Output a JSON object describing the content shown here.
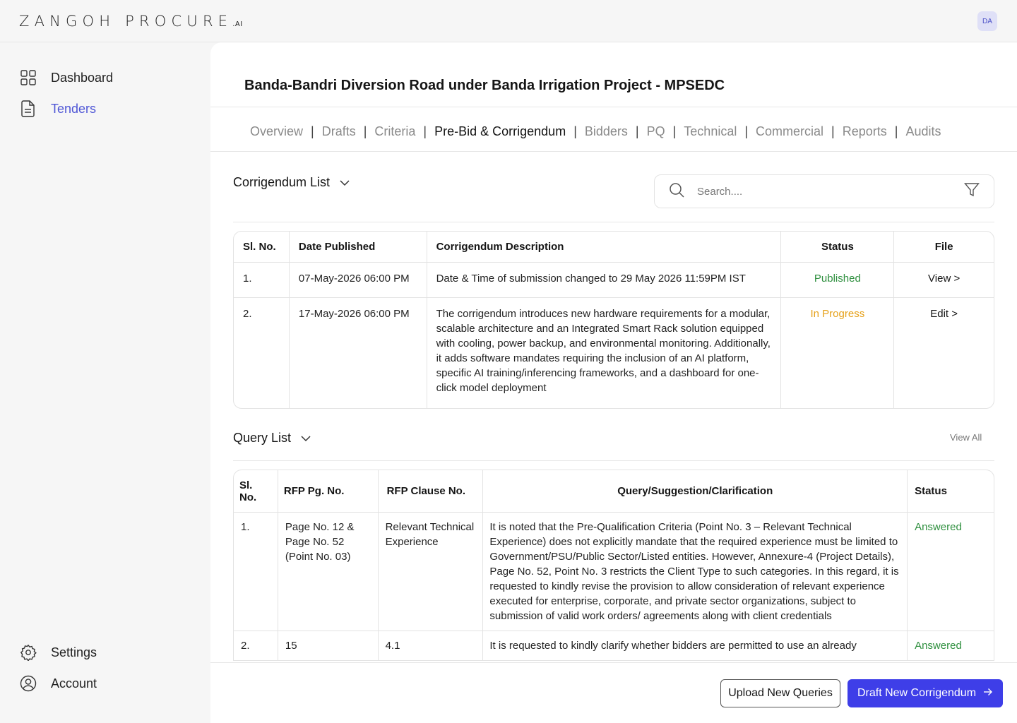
{
  "brand": {
    "name": "ZANGOH PROCURE",
    "suffix": ".AI"
  },
  "user": {
    "initials": "DA"
  },
  "sidebar": {
    "top": [
      {
        "label": "Dashboard",
        "icon": "grid-icon"
      },
      {
        "label": "Tenders",
        "icon": "document-icon",
        "active": true
      }
    ],
    "bottom": [
      {
        "label": "Settings",
        "icon": "gear-icon"
      },
      {
        "label": "Account",
        "icon": "user-circle-icon"
      }
    ]
  },
  "page": {
    "title": "Banda-Bandri Diversion Road under Banda Irrigation Project - MPSEDC"
  },
  "tabs": [
    "Overview",
    "Drafts",
    "Criteria",
    "Pre-Bid & Corrigendum",
    "Bidders",
    "PQ",
    "Technical",
    "Commercial",
    "Reports",
    "Audits"
  ],
  "active_tab": "Pre-Bid & Corrigendum",
  "corrigendum": {
    "title": "Corrigendum List",
    "search_placeholder": "Search....",
    "columns": [
      "Sl. No.",
      "Date Published",
      "Corrigendum Description",
      "Status",
      "File"
    ],
    "rows": [
      {
        "sl": "1.",
        "date": "07-May-2026 06:00 PM",
        "description": "Date & Time of submission changed to 29 May 2026 11:59PM IST",
        "status": "Published",
        "file": "View >"
      },
      {
        "sl": "2.",
        "date": "17-May-2026 06:00 PM",
        "description": "The corrigendum introduces new hardware requirements for a modular, scalable architecture and an Integrated Smart Rack solution equipped with cooling, power backup, and environmental monitoring. Additionally, it adds software mandates requiring the inclusion of an AI platform, specific AI training/inferencing frameworks, and a dashboard for one-click model deployment",
        "status": "In Progress",
        "file": "Edit >"
      }
    ]
  },
  "queries": {
    "title": "Query List",
    "view_all": "View All",
    "columns": [
      "Sl. No.",
      "RFP Pg. No.",
      "RFP Clause No.",
      "Query/Suggestion/Clarification",
      "Status"
    ],
    "rows": [
      {
        "sl": "1.",
        "page": "Page No. 12 & Page No. 52 (Point No. 03)",
        "clause": "Relevant Technical Experience",
        "query": "It is noted that the Pre-Qualification Criteria (Point No. 3 – Relevant Technical Experience) does not explicitly mandate that the required experience must be limited to Government/PSU/Public Sector/Listed entities. However, Annexure-4 (Project Details), Page No. 52, Point No. 3 restricts the Client Type to such categories. In this regard, it is requested to kindly revise the provision to allow consideration of relevant experience executed for enterprise, corporate, and private sector organizations, subject to submission of valid work orders/ agreements along with client credentials",
        "status": "Answered"
      },
      {
        "sl": "2.",
        "page": "15",
        "clause": "4.1",
        "query": "It is requested to kindly clarify whether bidders are permitted to use an already",
        "status": "Answered"
      }
    ]
  },
  "footer": {
    "upload_label": "Upload New Queries",
    "draft_label": "Draft New Corrigendum"
  },
  "colors": {
    "accent": "#4f56d6",
    "primary_button": "#3e3ee8",
    "published": "#2e8f3e",
    "in_progress": "#e6a11a"
  }
}
